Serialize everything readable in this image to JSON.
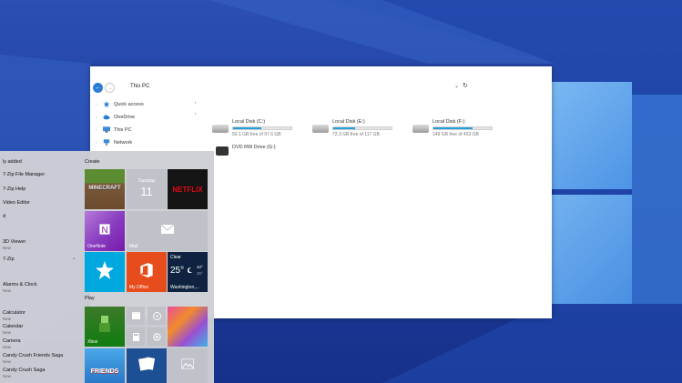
{
  "explorer": {
    "title": "This PC",
    "tree": [
      {
        "label": "Quick access"
      },
      {
        "label": "OneDrive"
      },
      {
        "label": "This PC"
      },
      {
        "label": "Network"
      }
    ],
    "drives": [
      {
        "name": "Local Disk (C:)",
        "free": "50.1 GB free of 97.6 GB",
        "used_fraction": 0.49
      },
      {
        "name": "Local Disk (E:)",
        "free": "72.3 GB free of 117 GB",
        "used_fraction": 0.38
      },
      {
        "name": "Local Disk (F:)",
        "free": "149 GB free of 453 GB",
        "used_fraction": 0.67
      },
      {
        "name": "DVD RW Drive (G:)"
      }
    ]
  },
  "start": {
    "recent_header": "ly added",
    "apps": [
      {
        "label": "7-Zip File Manager"
      },
      {
        "label": "7-Zip Help"
      },
      {
        "label": "Video Editor"
      },
      {
        "label": "d"
      },
      {
        "label": "3D Viewer",
        "sub": "New"
      },
      {
        "label": "7-Zip"
      },
      {
        "label": "Alarms & Clock",
        "sub": "New"
      },
      {
        "label": "Calculator",
        "sub": "New"
      },
      {
        "label": "Calendar",
        "sub": "New"
      },
      {
        "label": "Camera",
        "sub": "New"
      },
      {
        "label": "Candy Crush Friends Saga",
        "sub": "New"
      },
      {
        "label": "Candy Crush Saga",
        "sub": "New"
      }
    ],
    "create_label": "Create",
    "play_label": "Play",
    "tiles": {
      "calendar_day": "Tuesday",
      "calendar_date": "11",
      "netflix": "NETFLIX",
      "onenote": "OneNote",
      "mail": "Mail",
      "myoffice": "My Office",
      "weather_condition": "Clear",
      "weather_temp": "25°",
      "weather_high": "42°",
      "weather_low": "25°",
      "weather_city": "Washington,...",
      "xbox": "Xbox",
      "minecraft": "MINECRAFT",
      "friends": "FRIENDS"
    }
  },
  "colors": {
    "accent": "#2b7cd3",
    "desktop": "#1f3f9e",
    "onenote": "#7719aa",
    "office": "#e74c1c",
    "store_teal": "#00a8e0",
    "weather": "#0f2340",
    "xbox": "#107c10",
    "netflix": "#e50914"
  }
}
